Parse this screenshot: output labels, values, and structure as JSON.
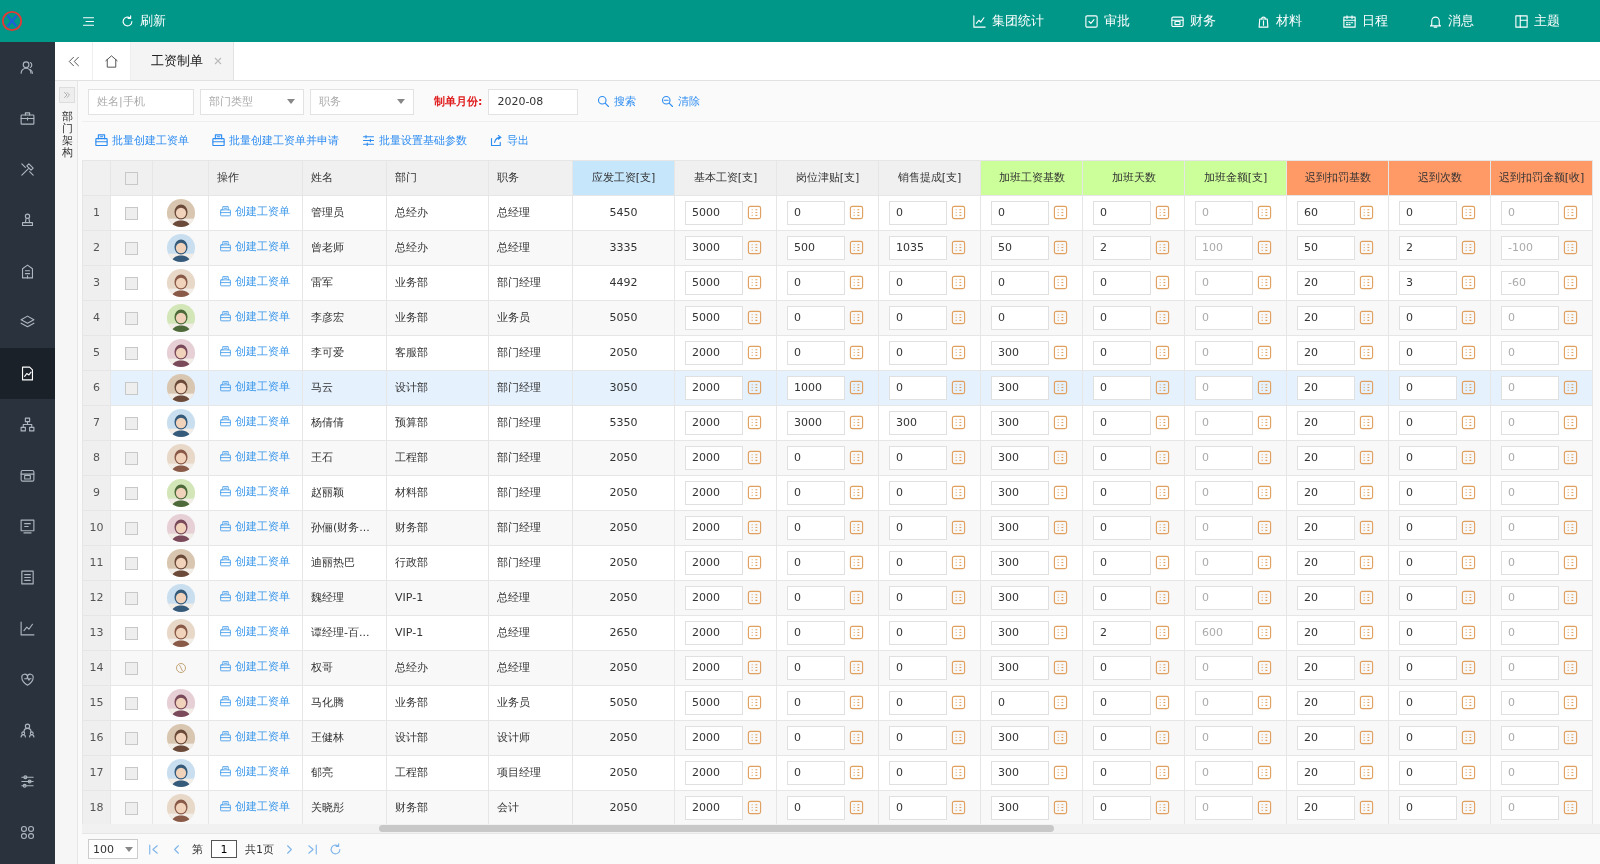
{
  "top_bar": {
    "refresh": "刷新",
    "nav": [
      {
        "label": "集团统计"
      },
      {
        "label": "审批"
      },
      {
        "label": "财务"
      },
      {
        "label": "材料"
      },
      {
        "label": "日程"
      },
      {
        "label": "消息"
      },
      {
        "label": "主题"
      }
    ]
  },
  "sidebar": {
    "items": [
      {
        "selected": false
      },
      {
        "selected": false
      },
      {
        "selected": false
      },
      {
        "selected": false
      },
      {
        "selected": false
      },
      {
        "selected": false
      },
      {
        "selected": true
      },
      {
        "selected": false
      },
      {
        "selected": false
      },
      {
        "selected": false
      },
      {
        "selected": false
      },
      {
        "selected": false
      },
      {
        "selected": false
      },
      {
        "selected": false
      },
      {
        "selected": false
      },
      {
        "selected": false
      }
    ]
  },
  "tabs": [
    {
      "label": "工资制单",
      "selected": true
    }
  ],
  "side_panel": {
    "title": "部门架构"
  },
  "filters": {
    "name_field": {
      "placeholder": "姓名|手机"
    },
    "dept_select": {
      "placeholder": "部门类型"
    },
    "position_select": {
      "placeholder": "职务"
    },
    "month_label": "制单月份:",
    "month_field": {
      "value": "2020-08"
    },
    "search_button": "搜索",
    "clear_button": "清除"
  },
  "actions": [
    {
      "label": "批量创建工资单",
      "kind": "create"
    },
    {
      "label": "批量创建工资单并申请",
      "kind": "create"
    },
    {
      "label": "批量设置基础参数",
      "kind": "settings"
    },
    {
      "label": "导出",
      "kind": "export"
    }
  ],
  "table": {
    "header_checked": false,
    "columns": [
      {
        "label": "操作",
        "kind": "action",
        "color": "#f0f0f0"
      },
      {
        "label": "姓名",
        "kind": "text",
        "color": "#f0f0f0"
      },
      {
        "label": "部门",
        "kind": "text",
        "color": "#f0f0f0"
      },
      {
        "label": "职务",
        "kind": "text",
        "color": "#f0f0f0"
      },
      {
        "label": "应发工资[支]",
        "kind": "number",
        "color": "#c6e6fc"
      },
      {
        "label": "基本工资[支]",
        "kind": "input",
        "color": "#f0f0f0"
      },
      {
        "label": "岗位津贴[支]",
        "kind": "input",
        "color": "#f0f0f0"
      },
      {
        "label": "销售提成[支]",
        "kind": "input",
        "color": "#f0f0f0"
      },
      {
        "label": "加班工资基数",
        "kind": "input",
        "color": "#ccff99"
      },
      {
        "label": "加班天数",
        "kind": "input",
        "color": "#ccff99"
      },
      {
        "label": "加班金额[支]",
        "kind": "readonly",
        "color": "#ccff99"
      },
      {
        "label": "迟到扣罚基数",
        "kind": "input",
        "color": "#ff9966"
      },
      {
        "label": "迟到次数",
        "kind": "input",
        "color": "#ff9966"
      },
      {
        "label": "迟到扣罚金额[收]",
        "kind": "readonly",
        "color": "#ff9966"
      }
    ],
    "rows": [
      {
        "index": "1",
        "selected": false,
        "checked": false,
        "cells": [
          "创建工资单",
          "管理员",
          "总经办",
          "总经理",
          "5450",
          "5000",
          "0",
          "0",
          "0",
          "0",
          "0",
          "60",
          "0",
          "0"
        ]
      },
      {
        "index": "2",
        "selected": false,
        "checked": false,
        "cells": [
          "创建工资单",
          "曾老师",
          "总经办",
          "总经理",
          "3335",
          "3000",
          "500",
          "1035",
          "50",
          "2",
          "100",
          "50",
          "2",
          "-100"
        ]
      },
      {
        "index": "3",
        "selected": false,
        "checked": false,
        "cells": [
          "创建工资单",
          "雷军",
          "业务部",
          "部门经理",
          "4492",
          "5000",
          "0",
          "0",
          "0",
          "0",
          "0",
          "20",
          "3",
          "-60"
        ]
      },
      {
        "index": "4",
        "selected": false,
        "checked": false,
        "cells": [
          "创建工资单",
          "李彦宏",
          "业务部",
          "业务员",
          "5050",
          "5000",
          "0",
          "0",
          "0",
          "0",
          "0",
          "20",
          "0",
          "0"
        ]
      },
      {
        "index": "5",
        "selected": false,
        "checked": false,
        "cells": [
          "创建工资单",
          "李可爱",
          "客服部",
          "部门经理",
          "2050",
          "2000",
          "0",
          "0",
          "300",
          "0",
          "0",
          "20",
          "0",
          "0"
        ]
      },
      {
        "index": "6",
        "selected": true,
        "checked": false,
        "cells": [
          "创建工资单",
          "马云",
          "设计部",
          "部门经理",
          "3050",
          "2000",
          "1000",
          "0",
          "300",
          "0",
          "0",
          "20",
          "0",
          "0"
        ]
      },
      {
        "index": "7",
        "selected": false,
        "checked": false,
        "cells": [
          "创建工资单",
          "杨倩倩",
          "预算部",
          "部门经理",
          "5350",
          "2000",
          "3000",
          "300",
          "300",
          "0",
          "0",
          "20",
          "0",
          "0"
        ]
      },
      {
        "index": "8",
        "selected": false,
        "checked": false,
        "cells": [
          "创建工资单",
          "王石",
          "工程部",
          "部门经理",
          "2050",
          "2000",
          "0",
          "0",
          "300",
          "0",
          "0",
          "20",
          "0",
          "0"
        ]
      },
      {
        "index": "9",
        "selected": false,
        "checked": false,
        "cells": [
          "创建工资单",
          "赵丽颖",
          "材料部",
          "部门经理",
          "2050",
          "2000",
          "0",
          "0",
          "300",
          "0",
          "0",
          "20",
          "0",
          "0"
        ]
      },
      {
        "index": "10",
        "selected": false,
        "checked": false,
        "cells": [
          "创建工资单",
          "孙俪(财务...",
          "财务部",
          "部门经理",
          "2050",
          "2000",
          "0",
          "0",
          "300",
          "0",
          "0",
          "20",
          "0",
          "0"
        ]
      },
      {
        "index": "11",
        "selected": false,
        "checked": false,
        "cells": [
          "创建工资单",
          "迪丽热巴",
          "行政部",
          "部门经理",
          "2050",
          "2000",
          "0",
          "0",
          "300",
          "0",
          "0",
          "20",
          "0",
          "0"
        ]
      },
      {
        "index": "12",
        "selected": false,
        "checked": false,
        "cells": [
          "创建工资单",
          "魏经理",
          "VIP-1",
          "总经理",
          "2050",
          "2000",
          "0",
          "0",
          "300",
          "0",
          "0",
          "20",
          "0",
          "0"
        ]
      },
      {
        "index": "13",
        "selected": false,
        "checked": false,
        "cells": [
          "创建工资单",
          "谭经理-百...",
          "VIP-1",
          "总经理",
          "2650",
          "2000",
          "0",
          "0",
          "300",
          "2",
          "600",
          "20",
          "0",
          "0"
        ]
      },
      {
        "index": "14",
        "selected": false,
        "checked": false,
        "kind": "logo",
        "cells": [
          "创建工资单",
          "权哥",
          "总经办",
          "总经理",
          "2050",
          "2000",
          "0",
          "0",
          "300",
          "0",
          "0",
          "20",
          "0",
          "0"
        ]
      },
      {
        "index": "15",
        "selected": false,
        "checked": false,
        "cells": [
          "创建工资单",
          "马化腾",
          "业务部",
          "业务员",
          "5050",
          "5000",
          "0",
          "0",
          "0",
          "0",
          "0",
          "20",
          "0",
          "0"
        ]
      },
      {
        "index": "16",
        "selected": false,
        "checked": false,
        "cells": [
          "创建工资单",
          "王健林",
          "设计部",
          "设计师",
          "2050",
          "2000",
          "0",
          "0",
          "300",
          "0",
          "0",
          "20",
          "0",
          "0"
        ]
      },
      {
        "index": "17",
        "selected": false,
        "checked": false,
        "cells": [
          "创建工资单",
          "郁亮",
          "工程部",
          "项目经理",
          "2050",
          "2000",
          "0",
          "0",
          "300",
          "0",
          "0",
          "20",
          "0",
          "0"
        ]
      },
      {
        "index": "18",
        "selected": false,
        "checked": false,
        "cells": [
          "创建工资单",
          "关晓彤",
          "财务部",
          "会计",
          "2050",
          "2000",
          "0",
          "0",
          "300",
          "0",
          "0",
          "20",
          "0",
          "0"
        ]
      }
    ]
  },
  "pager": {
    "page_size": "100",
    "page_prefix": "第",
    "page": "1",
    "page_suffix": "共1页"
  }
}
